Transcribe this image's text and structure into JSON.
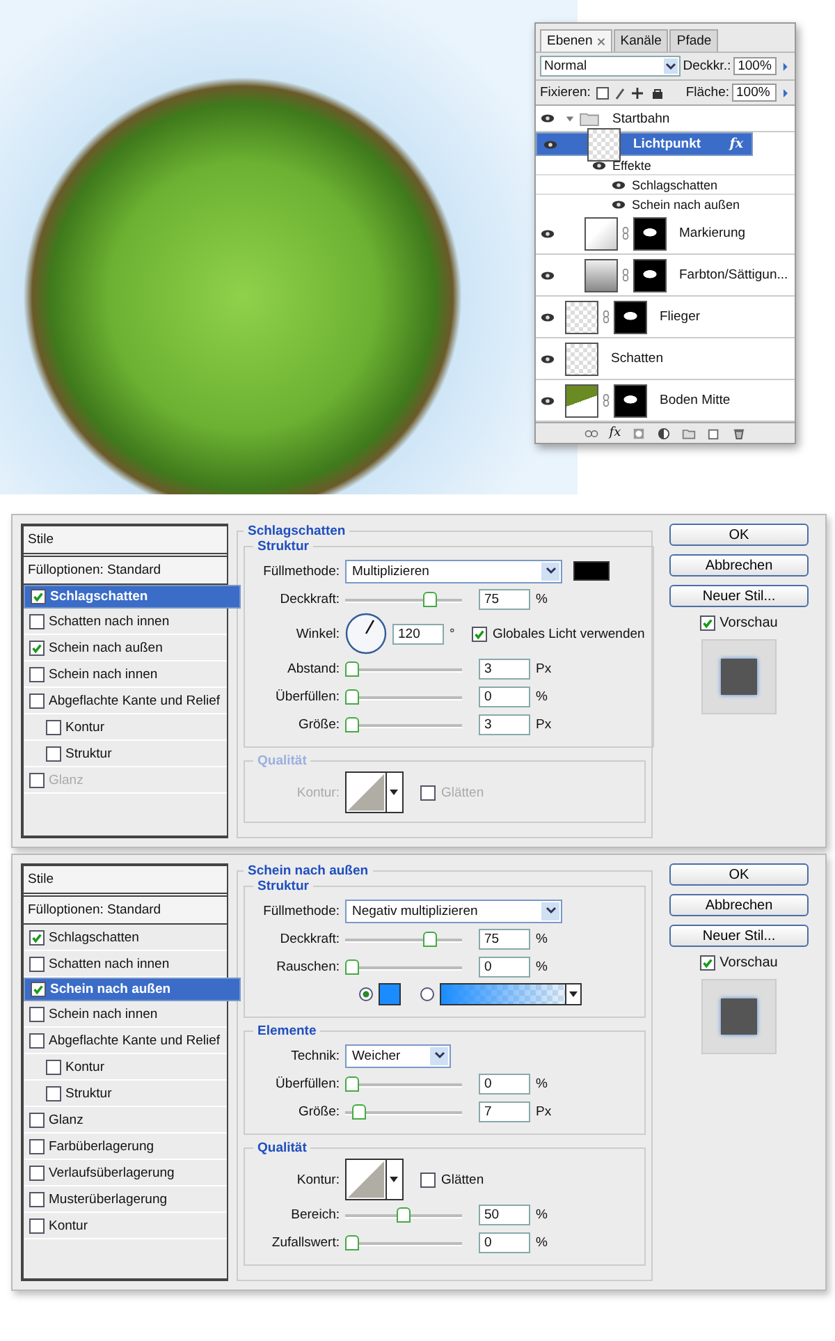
{
  "layers_panel": {
    "tabs": [
      {
        "label": "Ebenen",
        "selected": true,
        "closable": true
      },
      {
        "label": "Kanäle",
        "selected": false,
        "closable": false
      },
      {
        "label": "Pfade",
        "selected": false,
        "closable": false
      }
    ],
    "blend_mode": "Normal",
    "opacity_label": "Deckkr.:",
    "opacity": "100%",
    "lock_label": "Fixieren:",
    "fill_label": "Fläche:",
    "fill": "100%",
    "layers": [
      {
        "kind": "group",
        "name": "Startbahn",
        "expanded": true,
        "selected": false,
        "children": [
          {
            "kind": "pixel",
            "name": "Lichtpunkt",
            "selected": true,
            "mask": false,
            "fx": "fx",
            "effects_label": "Effekte",
            "effects": [
              "Schlagschatten",
              "Schein nach außen"
            ]
          },
          {
            "kind": "curves",
            "name": "Markierung",
            "selected": false,
            "mask": true
          },
          {
            "kind": "hue",
            "name": "Farbton/Sättigun...",
            "selected": false,
            "mask": true
          }
        ]
      },
      {
        "kind": "pixel",
        "name": "Flieger",
        "selected": false,
        "mask": true
      },
      {
        "kind": "pixel",
        "name": "Schatten",
        "selected": false,
        "mask": false
      },
      {
        "kind": "ground",
        "name": "Boden Mitte",
        "selected": false,
        "mask": true
      }
    ],
    "footer_fx": "fx"
  },
  "dialogs": [
    {
      "list_header": "Stile",
      "blend_options": "Fülloptionen: Standard",
      "styles": [
        {
          "label": "Schlagschatten",
          "checked": true,
          "selected": true,
          "disabled": false
        },
        {
          "label": "Schatten nach innen",
          "checked": false,
          "selected": false,
          "disabled": false
        },
        {
          "label": "Schein nach außen",
          "checked": true,
          "selected": false,
          "disabled": false
        },
        {
          "label": "Schein nach innen",
          "checked": false,
          "selected": false,
          "disabled": false
        },
        {
          "label": "Abgeflachte Kante und Relief",
          "checked": false,
          "selected": false,
          "disabled": false,
          "children": [
            {
              "label": "Kontur",
              "checked": false,
              "selected": false,
              "disabled": false
            },
            {
              "label": "Struktur",
              "checked": false,
              "selected": false,
              "disabled": false
            }
          ]
        },
        {
          "label": "Glanz",
          "checked": false,
          "selected": false,
          "disabled": true
        }
      ],
      "title": "Schlagschatten",
      "sections": [
        {
          "title": "Struktur",
          "disabled": false,
          "rows": [
            {
              "kind": "select",
              "label": "Füllmethode:",
              "value": "Multiplizieren",
              "color": "#000000",
              "narrow": false
            },
            {
              "kind": "slider",
              "label": "Deckkraft:",
              "level": 0.75,
              "value": "75",
              "unit": "%"
            },
            {
              "kind": "angle",
              "label": "Winkel:",
              "value": "120",
              "unit": "°",
              "check_label": "Globales Licht verwenden",
              "checked": true
            },
            {
              "kind": "slider",
              "label": "Abstand:",
              "level": 0,
              "value": "3",
              "unit": "Px"
            },
            {
              "kind": "slider",
              "label": "Überfüllen:",
              "level": 0,
              "value": "0",
              "unit": "%"
            },
            {
              "kind": "slider",
              "label": "Größe:",
              "level": 0,
              "value": "3",
              "unit": "Px"
            }
          ]
        },
        {
          "title": "Qualität",
          "disabled": true,
          "rows": [
            {
              "kind": "contour",
              "label": "Kontur:",
              "check_label": "Glätten",
              "checked": false
            }
          ]
        }
      ],
      "buttons": [
        "OK",
        "Abbrechen",
        "Neuer Stil..."
      ],
      "preview_label": "Vorschau",
      "preview_checked": true
    },
    {
      "list_header": "Stile",
      "blend_options": "Fülloptionen: Standard",
      "styles": [
        {
          "label": "Schlagschatten",
          "checked": true,
          "selected": false,
          "disabled": false
        },
        {
          "label": "Schatten nach innen",
          "checked": false,
          "selected": false,
          "disabled": false
        },
        {
          "label": "Schein nach außen",
          "checked": true,
          "selected": true,
          "disabled": false
        },
        {
          "label": "Schein nach innen",
          "checked": false,
          "selected": false,
          "disabled": false
        },
        {
          "label": "Abgeflachte Kante und Relief",
          "checked": false,
          "selected": false,
          "disabled": false,
          "children": [
            {
              "label": "Kontur",
              "checked": false,
              "selected": false,
              "disabled": false
            },
            {
              "label": "Struktur",
              "checked": false,
              "selected": false,
              "disabled": false
            }
          ]
        },
        {
          "label": "Glanz",
          "checked": false,
          "selected": false,
          "disabled": false
        },
        {
          "label": "Farbüberlagerung",
          "checked": false,
          "selected": false,
          "disabled": false
        },
        {
          "label": "Verlaufsüberlagerung",
          "checked": false,
          "selected": false,
          "disabled": false
        },
        {
          "label": "Musterüberlagerung",
          "checked": false,
          "selected": false,
          "disabled": false
        },
        {
          "label": "Kontur",
          "checked": false,
          "selected": false,
          "disabled": false
        }
      ],
      "title": "Schein nach außen",
      "sections": [
        {
          "title": "Struktur",
          "disabled": false,
          "rows": [
            {
              "kind": "select",
              "label": "Füllmethode:",
              "value": "Negativ multiplizieren",
              "narrow": false
            },
            {
              "kind": "slider",
              "label": "Deckkraft:",
              "level": 0.75,
              "value": "75",
              "unit": "%"
            },
            {
              "kind": "slider",
              "label": "Rauschen:",
              "level": 0,
              "value": "0",
              "unit": "%"
            },
            {
              "kind": "fill",
              "options": [
                {
                  "kind": "solid",
                  "selected": true,
                  "color": "#1a8cff"
                },
                {
                  "kind": "gradient",
                  "selected": false
                }
              ]
            }
          ]
        },
        {
          "title": "Elemente",
          "disabled": false,
          "rows": [
            {
              "kind": "select",
              "label": "Technik:",
              "value": "Weicher",
              "narrow": true
            },
            {
              "kind": "slider",
              "label": "Überfüllen:",
              "level": 0,
              "value": "0",
              "unit": "%"
            },
            {
              "kind": "slider",
              "label": "Größe:",
              "level": 0.07,
              "value": "7",
              "unit": "Px"
            }
          ]
        },
        {
          "title": "Qualität",
          "disabled": false,
          "rows": [
            {
              "kind": "contour",
              "label": "Kontur:",
              "check_label": "Glätten",
              "checked": false
            },
            {
              "kind": "slider",
              "label": "Bereich:",
              "level": 0.5,
              "value": "50",
              "unit": "%"
            },
            {
              "kind": "slider",
              "label": "Zufallswert:",
              "level": 0,
              "value": "0",
              "unit": "%"
            }
          ]
        }
      ],
      "buttons": [
        "OK",
        "Abbrechen",
        "Neuer Stil..."
      ],
      "preview_label": "Vorschau",
      "preview_checked": true
    }
  ]
}
